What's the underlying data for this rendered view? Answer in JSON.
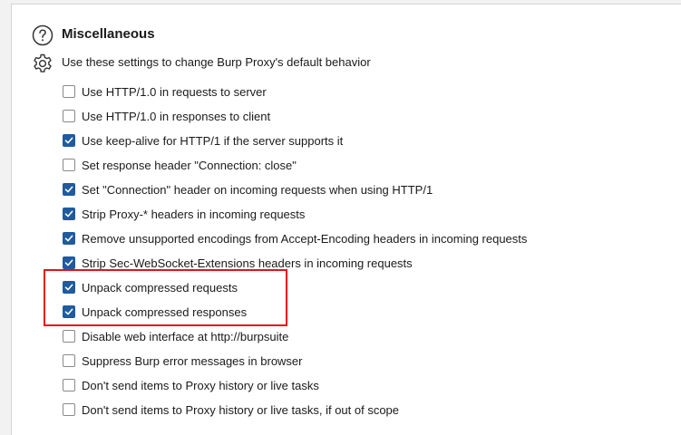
{
  "section": {
    "title": "Miscellaneous",
    "description": "Use these settings to change Burp Proxy's default behavior",
    "help_icon": "help-icon",
    "settings_icon": "gear-icon"
  },
  "options": [
    {
      "label": "Use HTTP/1.0 in requests to server",
      "checked": false
    },
    {
      "label": "Use HTTP/1.0 in responses to client",
      "checked": false
    },
    {
      "label": "Use keep-alive for HTTP/1 if the server supports it",
      "checked": true
    },
    {
      "label": "Set response header \"Connection: close\"",
      "checked": false
    },
    {
      "label": "Set \"Connection\" header on incoming requests when using HTTP/1",
      "checked": true
    },
    {
      "label": "Strip Proxy-* headers in incoming requests",
      "checked": true
    },
    {
      "label": "Remove unsupported encodings from Accept-Encoding headers in incoming requests",
      "checked": true
    },
    {
      "label": "Strip Sec-WebSocket-Extensions headers in incoming requests",
      "checked": true
    },
    {
      "label": "Unpack compressed requests",
      "checked": true
    },
    {
      "label": "Unpack compressed responses",
      "checked": true
    },
    {
      "label": "Disable web interface at http://burpsuite",
      "checked": false
    },
    {
      "label": "Suppress Burp error messages in browser",
      "checked": false
    },
    {
      "label": "Don't send items to Proxy history or live tasks",
      "checked": false
    },
    {
      "label": "Don't send items to Proxy history or live tasks, if out of scope",
      "checked": false
    }
  ],
  "colors": {
    "checkbox_checked": "#1f5b9e",
    "highlight": "#e8101a"
  }
}
